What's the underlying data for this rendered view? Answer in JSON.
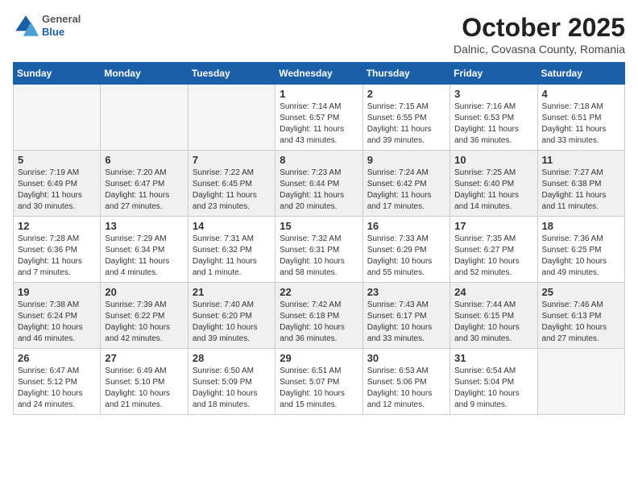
{
  "logo": {
    "general": "General",
    "blue": "Blue"
  },
  "header": {
    "month_title": "October 2025",
    "subtitle": "Dalnic, Covasna County, Romania"
  },
  "weekdays": [
    "Sunday",
    "Monday",
    "Tuesday",
    "Wednesday",
    "Thursday",
    "Friday",
    "Saturday"
  ],
  "weeks": [
    [
      {
        "day": "",
        "info": ""
      },
      {
        "day": "",
        "info": ""
      },
      {
        "day": "",
        "info": ""
      },
      {
        "day": "1",
        "info": "Sunrise: 7:14 AM\nSunset: 6:57 PM\nDaylight: 11 hours and 43 minutes."
      },
      {
        "day": "2",
        "info": "Sunrise: 7:15 AM\nSunset: 6:55 PM\nDaylight: 11 hours and 39 minutes."
      },
      {
        "day": "3",
        "info": "Sunrise: 7:16 AM\nSunset: 6:53 PM\nDaylight: 11 hours and 36 minutes."
      },
      {
        "day": "4",
        "info": "Sunrise: 7:18 AM\nSunset: 6:51 PM\nDaylight: 11 hours and 33 minutes."
      }
    ],
    [
      {
        "day": "5",
        "info": "Sunrise: 7:19 AM\nSunset: 6:49 PM\nDaylight: 11 hours and 30 minutes."
      },
      {
        "day": "6",
        "info": "Sunrise: 7:20 AM\nSunset: 6:47 PM\nDaylight: 11 hours and 27 minutes."
      },
      {
        "day": "7",
        "info": "Sunrise: 7:22 AM\nSunset: 6:45 PM\nDaylight: 11 hours and 23 minutes."
      },
      {
        "day": "8",
        "info": "Sunrise: 7:23 AM\nSunset: 6:44 PM\nDaylight: 11 hours and 20 minutes."
      },
      {
        "day": "9",
        "info": "Sunrise: 7:24 AM\nSunset: 6:42 PM\nDaylight: 11 hours and 17 minutes."
      },
      {
        "day": "10",
        "info": "Sunrise: 7:25 AM\nSunset: 6:40 PM\nDaylight: 11 hours and 14 minutes."
      },
      {
        "day": "11",
        "info": "Sunrise: 7:27 AM\nSunset: 6:38 PM\nDaylight: 11 hours and 11 minutes."
      }
    ],
    [
      {
        "day": "12",
        "info": "Sunrise: 7:28 AM\nSunset: 6:36 PM\nDaylight: 11 hours and 7 minutes."
      },
      {
        "day": "13",
        "info": "Sunrise: 7:29 AM\nSunset: 6:34 PM\nDaylight: 11 hours and 4 minutes."
      },
      {
        "day": "14",
        "info": "Sunrise: 7:31 AM\nSunset: 6:32 PM\nDaylight: 11 hours and 1 minute."
      },
      {
        "day": "15",
        "info": "Sunrise: 7:32 AM\nSunset: 6:31 PM\nDaylight: 10 hours and 58 minutes."
      },
      {
        "day": "16",
        "info": "Sunrise: 7:33 AM\nSunset: 6:29 PM\nDaylight: 10 hours and 55 minutes."
      },
      {
        "day": "17",
        "info": "Sunrise: 7:35 AM\nSunset: 6:27 PM\nDaylight: 10 hours and 52 minutes."
      },
      {
        "day": "18",
        "info": "Sunrise: 7:36 AM\nSunset: 6:25 PM\nDaylight: 10 hours and 49 minutes."
      }
    ],
    [
      {
        "day": "19",
        "info": "Sunrise: 7:38 AM\nSunset: 6:24 PM\nDaylight: 10 hours and 46 minutes."
      },
      {
        "day": "20",
        "info": "Sunrise: 7:39 AM\nSunset: 6:22 PM\nDaylight: 10 hours and 42 minutes."
      },
      {
        "day": "21",
        "info": "Sunrise: 7:40 AM\nSunset: 6:20 PM\nDaylight: 10 hours and 39 minutes."
      },
      {
        "day": "22",
        "info": "Sunrise: 7:42 AM\nSunset: 6:18 PM\nDaylight: 10 hours and 36 minutes."
      },
      {
        "day": "23",
        "info": "Sunrise: 7:43 AM\nSunset: 6:17 PM\nDaylight: 10 hours and 33 minutes."
      },
      {
        "day": "24",
        "info": "Sunrise: 7:44 AM\nSunset: 6:15 PM\nDaylight: 10 hours and 30 minutes."
      },
      {
        "day": "25",
        "info": "Sunrise: 7:46 AM\nSunset: 6:13 PM\nDaylight: 10 hours and 27 minutes."
      }
    ],
    [
      {
        "day": "26",
        "info": "Sunrise: 6:47 AM\nSunset: 5:12 PM\nDaylight: 10 hours and 24 minutes."
      },
      {
        "day": "27",
        "info": "Sunrise: 6:49 AM\nSunset: 5:10 PM\nDaylight: 10 hours and 21 minutes."
      },
      {
        "day": "28",
        "info": "Sunrise: 6:50 AM\nSunset: 5:09 PM\nDaylight: 10 hours and 18 minutes."
      },
      {
        "day": "29",
        "info": "Sunrise: 6:51 AM\nSunset: 5:07 PM\nDaylight: 10 hours and 15 minutes."
      },
      {
        "day": "30",
        "info": "Sunrise: 6:53 AM\nSunset: 5:06 PM\nDaylight: 10 hours and 12 minutes."
      },
      {
        "day": "31",
        "info": "Sunrise: 6:54 AM\nSunset: 5:04 PM\nDaylight: 10 hours and 9 minutes."
      },
      {
        "day": "",
        "info": ""
      }
    ]
  ]
}
